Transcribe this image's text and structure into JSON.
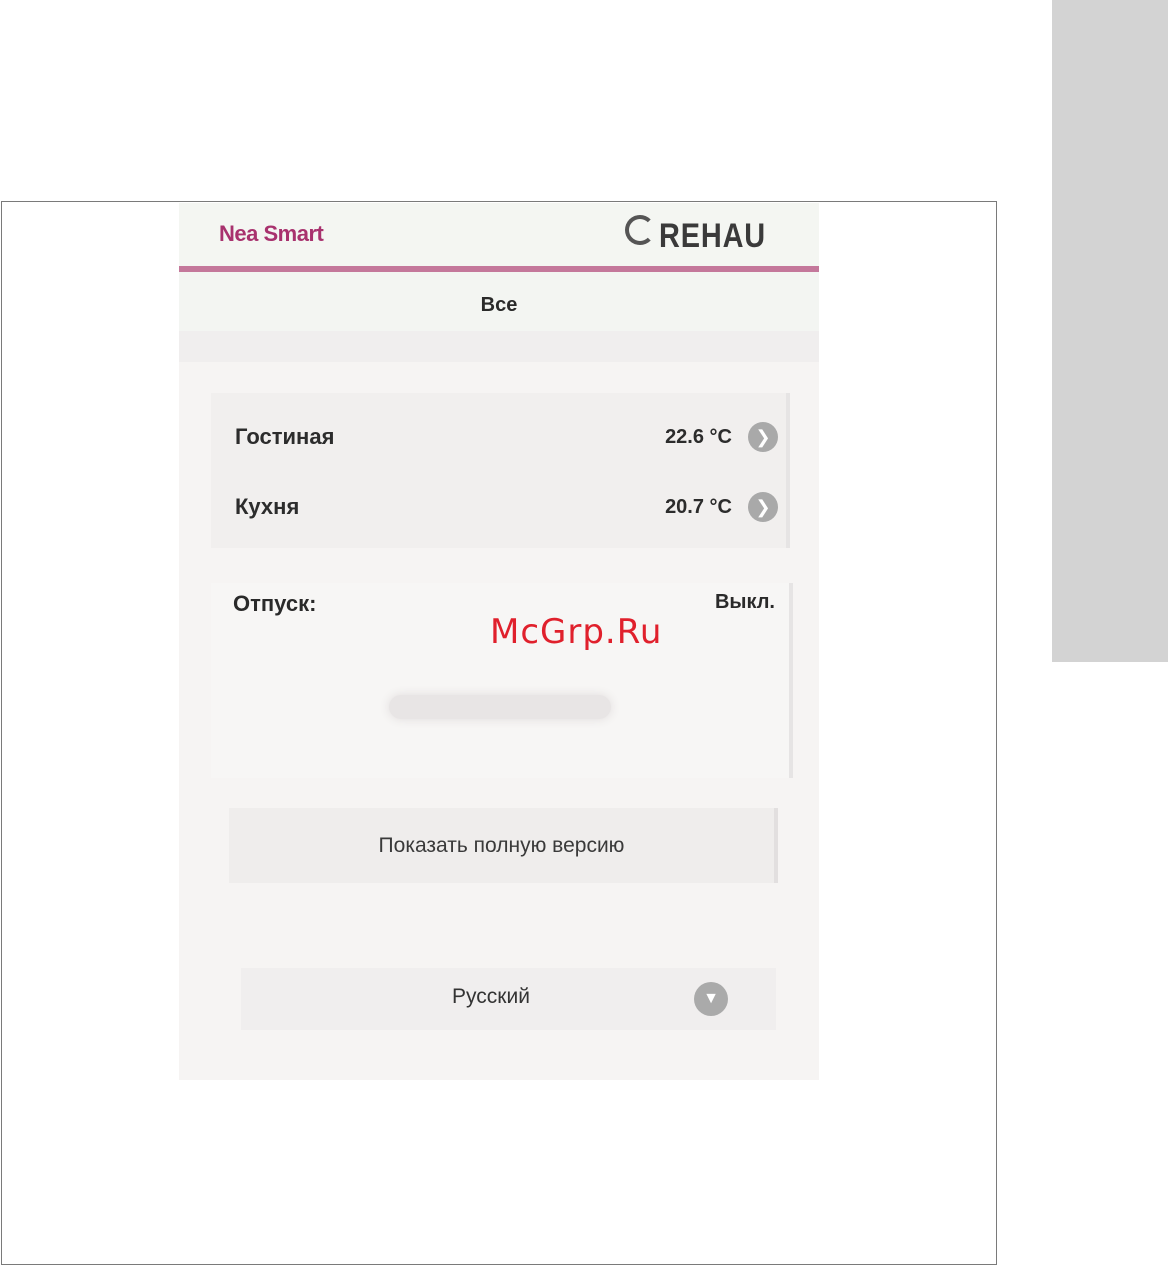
{
  "header": {
    "brand": "Nea Smart",
    "logo_text": "REHAU"
  },
  "nav": {
    "current": "Все"
  },
  "rooms": [
    {
      "name": "Гостиная",
      "temperature": "22.6 °C",
      "icon": "chevron-right-icon"
    },
    {
      "name": "Кухня",
      "temperature": "20.7 °C",
      "icon": "chevron-right-icon"
    }
  ],
  "vacation": {
    "label": "Отпуск:",
    "value": "Выкл."
  },
  "actions": {
    "full_version": "Показать полную версию"
  },
  "language": {
    "selected": "Русский",
    "icon": "chevron-down-icon"
  },
  "watermark": "McGrp.Ru",
  "colors": {
    "brand": "#a8326e",
    "accent_line": "#c4789b",
    "watermark": "#e0202c"
  }
}
